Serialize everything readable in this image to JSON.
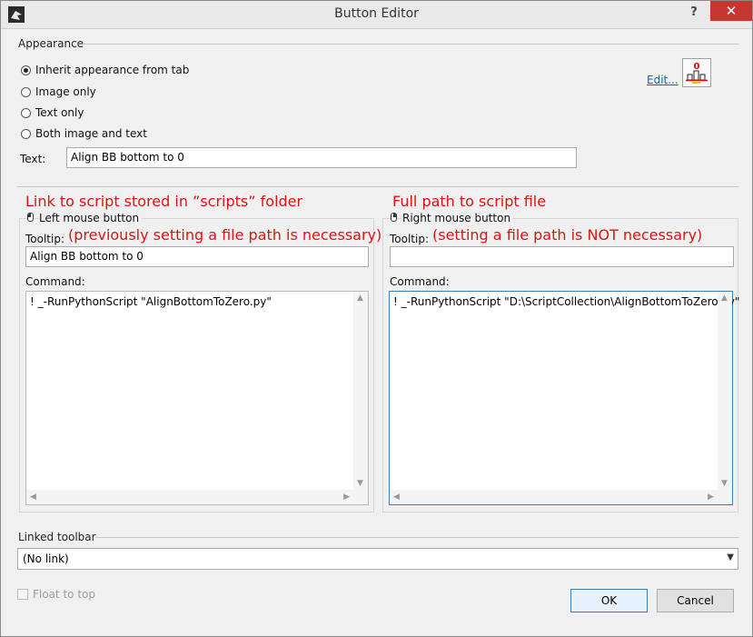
{
  "window": {
    "title": "Button Editor",
    "help_label": "?",
    "close_label": "✕"
  },
  "appearance": {
    "group_label": "Appearance",
    "options": [
      {
        "label": "Inherit appearance from tab",
        "checked": true
      },
      {
        "label": "Image only",
        "checked": false
      },
      {
        "label": "Text only",
        "checked": false
      },
      {
        "label": "Both image and text",
        "checked": false
      }
    ],
    "text_label": "Text:",
    "text_value": "Align BB bottom to 0",
    "edit_link": "Edit...",
    "preview_badge": "0"
  },
  "annotations": {
    "left_title": "Link to script stored in ”scripts” folder",
    "left_note": "(previously setting a file path is necessary)",
    "right_title": "Full path to script file",
    "right_note": "(setting a file path is NOT necessary)"
  },
  "left_panel": {
    "label": "Left mouse button",
    "tooltip_label": "Tooltip:",
    "tooltip_value": "Align BB bottom to 0",
    "command_label": "Command:",
    "command_value": "! _-RunPythonScript \"AlignBottomToZero.py\""
  },
  "right_panel": {
    "label": "Right mouse button",
    "tooltip_label": "Tooltip:",
    "tooltip_value": "",
    "command_label": "Command:",
    "command_value": "! _-RunPythonScript \"D:\\ScriptCollection\\AlignBottomToZero.py\""
  },
  "linked_toolbar": {
    "group_label": "Linked toolbar",
    "selected": "(No link)"
  },
  "footer": {
    "float_label": "Float to top",
    "ok_label": "OK",
    "cancel_label": "Cancel"
  },
  "colors": {
    "annotation": "#e0120f",
    "close": "#c7372f",
    "link": "#1a5fb4"
  }
}
